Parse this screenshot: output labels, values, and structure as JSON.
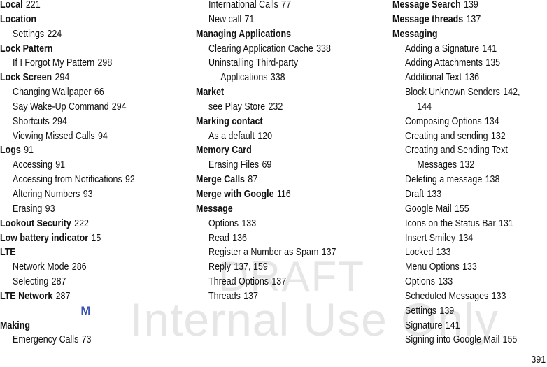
{
  "watermark": {
    "line1": "DRAFT",
    "line2": "Internal Use Only"
  },
  "columns": [
    {
      "entries": [
        {
          "level": "main",
          "term": "Local",
          "pages": "221"
        },
        {
          "level": "main",
          "term": "Location",
          "pages": ""
        },
        {
          "level": "sub",
          "term": "Settings",
          "pages": "224"
        },
        {
          "level": "main",
          "term": "Lock Pattern",
          "pages": ""
        },
        {
          "level": "sub",
          "term": "If I Forgot My Pattern",
          "pages": "298"
        },
        {
          "level": "main",
          "term": "Lock Screen",
          "pages": "294"
        },
        {
          "level": "sub",
          "term": "Changing Wallpaper",
          "pages": "66"
        },
        {
          "level": "sub",
          "term": "Say Wake-Up Command",
          "pages": "294"
        },
        {
          "level": "sub",
          "term": "Shortcuts",
          "pages": "294"
        },
        {
          "level": "sub",
          "term": "Viewing Missed Calls",
          "pages": "94"
        },
        {
          "level": "main",
          "term": "Logs",
          "pages": "91"
        },
        {
          "level": "sub",
          "term": "Accessing",
          "pages": "91"
        },
        {
          "level": "sub",
          "term": "Accessing from Notifications",
          "pages": "92"
        },
        {
          "level": "sub",
          "term": "Altering Numbers",
          "pages": "93"
        },
        {
          "level": "sub",
          "term": "Erasing",
          "pages": "93"
        },
        {
          "level": "main",
          "term": "Lookout Security",
          "pages": "222"
        },
        {
          "level": "main",
          "term": "Low battery indicator",
          "pages": "15"
        },
        {
          "level": "main",
          "term": "LTE",
          "pages": ""
        },
        {
          "level": "sub",
          "term": "Network Mode",
          "pages": "286"
        },
        {
          "level": "sub",
          "term": "Selecting",
          "pages": "287"
        },
        {
          "level": "main",
          "term": "LTE Network",
          "pages": "287"
        },
        {
          "level": "letter",
          "term": "M",
          "pages": ""
        },
        {
          "level": "main",
          "term": "Making",
          "pages": ""
        },
        {
          "level": "sub",
          "term": "Emergency Calls",
          "pages": "73"
        }
      ]
    },
    {
      "entries": [
        {
          "level": "sub",
          "term": "International Calls",
          "pages": "77"
        },
        {
          "level": "sub",
          "term": "New call",
          "pages": "71"
        },
        {
          "level": "main",
          "term": "Managing Applications",
          "pages": ""
        },
        {
          "level": "sub",
          "term": "Clearing Application Cache",
          "pages": "338"
        },
        {
          "level": "sub",
          "term": "Uninstalling Third-party",
          "pages": ""
        },
        {
          "level": "sub2",
          "term": "Applications",
          "pages": "338"
        },
        {
          "level": "main",
          "term": "Market",
          "pages": ""
        },
        {
          "level": "sub",
          "term": "see Play Store",
          "pages": "232"
        },
        {
          "level": "main",
          "term": "Marking contact",
          "pages": ""
        },
        {
          "level": "sub",
          "term": "As a default",
          "pages": "120"
        },
        {
          "level": "main",
          "term": "Memory Card",
          "pages": ""
        },
        {
          "level": "sub",
          "term": "Erasing Files",
          "pages": "69"
        },
        {
          "level": "main",
          "term": "Merge Calls",
          "pages": "87"
        },
        {
          "level": "main",
          "term": "Merge with Google",
          "pages": "116"
        },
        {
          "level": "main",
          "term": "Message",
          "pages": ""
        },
        {
          "level": "sub",
          "term": "Options",
          "pages": "133"
        },
        {
          "level": "sub",
          "term": "Read",
          "pages": "136"
        },
        {
          "level": "sub",
          "term": "Register a Number as Spam",
          "pages": "137"
        },
        {
          "level": "sub",
          "term": "Reply",
          "pages": "137, 159"
        },
        {
          "level": "sub",
          "term": "Thread Options",
          "pages": "137"
        },
        {
          "level": "sub",
          "term": "Threads",
          "pages": "137"
        }
      ]
    },
    {
      "entries": [
        {
          "level": "main",
          "term": "Message Search",
          "pages": "139"
        },
        {
          "level": "main",
          "term": "Message threads",
          "pages": "137"
        },
        {
          "level": "main",
          "term": "Messaging",
          "pages": ""
        },
        {
          "level": "sub",
          "term": "Adding a Signature",
          "pages": "141"
        },
        {
          "level": "sub",
          "term": "Adding Attachments",
          "pages": "135"
        },
        {
          "level": "sub",
          "term": "Additional Text",
          "pages": "136"
        },
        {
          "level": "sub",
          "term": "Block Unknown Senders",
          "pages": "142,"
        },
        {
          "level": "sub2",
          "term": "",
          "pages": "144"
        },
        {
          "level": "sub",
          "term": "Composing Options",
          "pages": "134"
        },
        {
          "level": "sub",
          "term": "Creating and sending",
          "pages": "132"
        },
        {
          "level": "sub",
          "term": "Creating and Sending Text",
          "pages": ""
        },
        {
          "level": "sub2",
          "term": "Messages",
          "pages": "132"
        },
        {
          "level": "sub",
          "term": "Deleting a message",
          "pages": "138"
        },
        {
          "level": "sub",
          "term": "Draft",
          "pages": "133"
        },
        {
          "level": "sub",
          "term": "Google Mail",
          "pages": "155"
        },
        {
          "level": "sub",
          "term": "Icons on the Status Bar",
          "pages": "131"
        },
        {
          "level": "sub",
          "term": "Insert Smiley",
          "pages": "134"
        },
        {
          "level": "sub",
          "term": "Locked",
          "pages": "133"
        },
        {
          "level": "sub",
          "term": "Menu Options",
          "pages": "133"
        },
        {
          "level": "sub",
          "term": "Options",
          "pages": "133"
        },
        {
          "level": "sub",
          "term": "Scheduled Messages",
          "pages": "133"
        },
        {
          "level": "sub",
          "term": "Settings",
          "pages": "139"
        },
        {
          "level": "sub",
          "term": "Signature",
          "pages": "141"
        },
        {
          "level": "sub",
          "term": "Signing into Google Mail",
          "pages": "155"
        }
      ]
    }
  ],
  "footer": {
    "page_number": "391"
  },
  "colors": {
    "letter_heading": "#3b52b5",
    "watermark": "#e6e6e6",
    "text": "#111111"
  }
}
